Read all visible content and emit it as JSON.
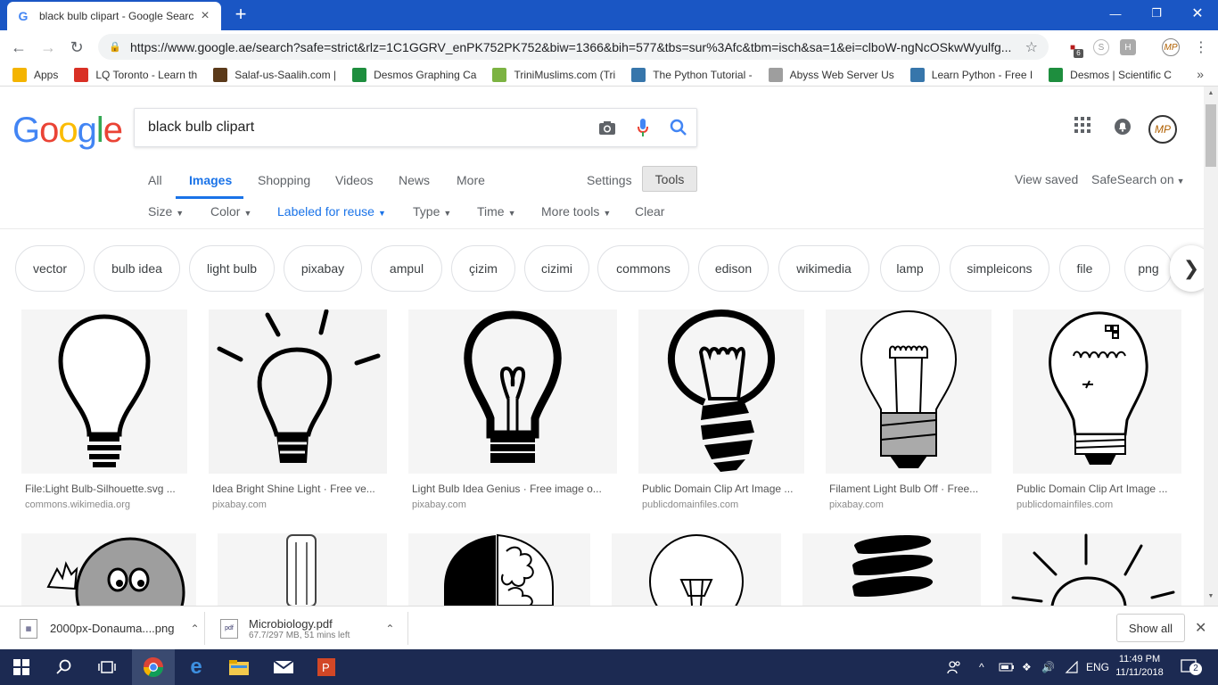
{
  "browser": {
    "tab_title": "black bulb clipart - Google Searc",
    "url": "https://www.google.ae/search?safe=strict&rlz=1C1GGRV_enPK752PK752&biw=1366&bih=577&tbs=sur%3Afc&tbm=isch&sa=1&ei=clboW-ngNcOSkwWyulfg...",
    "extension_badge": "6"
  },
  "bookmarks": [
    {
      "label": "Apps",
      "icon": "apps-grid-icon",
      "color": "#f4b400"
    },
    {
      "label": "LQ Toronto - Learn th",
      "icon": "lq-icon",
      "color": "#d93025"
    },
    {
      "label": "Salaf-us-Saalih.com |",
      "icon": "salaf-icon",
      "color": "#5b3a1a"
    },
    {
      "label": "Desmos Graphing Ca",
      "icon": "desmos-icon",
      "color": "#1e8e3e"
    },
    {
      "label": "TriniMuslims.com (Tri",
      "icon": "flag-icon",
      "color": "#7cb342"
    },
    {
      "label": "The Python Tutorial -",
      "icon": "python-icon",
      "color": "#3776ab"
    },
    {
      "label": "Abyss Web Server Us",
      "icon": "page-icon",
      "color": "#9e9e9e"
    },
    {
      "label": "Learn Python - Free I",
      "icon": "python-icon",
      "color": "#3776ab"
    },
    {
      "label": "Desmos | Scientific C",
      "icon": "desmos-icon",
      "color": "#1e8e3e"
    }
  ],
  "search": {
    "query": "black bulb clipart",
    "logo_letters": [
      {
        "ch": "G",
        "color": "#4285f4"
      },
      {
        "ch": "o",
        "color": "#ea4335"
      },
      {
        "ch": "o",
        "color": "#fbbc05"
      },
      {
        "ch": "g",
        "color": "#4285f4"
      },
      {
        "ch": "l",
        "color": "#34a853"
      },
      {
        "ch": "e",
        "color": "#ea4335"
      }
    ]
  },
  "nav_tabs": {
    "all": "All",
    "images": "Images",
    "shopping": "Shopping",
    "videos": "Videos",
    "news": "News",
    "more": "More",
    "settings": "Settings",
    "tools": "Tools"
  },
  "header_right": {
    "view_saved": "View saved",
    "safesearch": "SafeSearch on"
  },
  "filters": {
    "size": "Size",
    "color": "Color",
    "labeled": "Labeled for reuse",
    "type": "Type",
    "time": "Time",
    "more_tools": "More tools",
    "clear": "Clear"
  },
  "chips": [
    "vector",
    "bulb idea",
    "light bulb",
    "pixabay",
    "ampul",
    "çizim",
    "cizimi",
    "commons",
    "edison",
    "wikimedia",
    "lamp",
    "simpleicons",
    "file",
    "png"
  ],
  "results": [
    {
      "title": "File:Light Bulb-Silhouette.svg ...",
      "source": "commons.wikimedia.org"
    },
    {
      "title": "Idea Bright Shine Light · Free ve...",
      "source": "pixabay.com"
    },
    {
      "title": "Light Bulb Idea Genius · Free image o...",
      "source": "pixabay.com"
    },
    {
      "title": "Public Domain Clip Art Image ...",
      "source": "publicdomainfiles.com"
    },
    {
      "title": "Filament Light Bulb Off · Free...",
      "source": "pixabay.com"
    },
    {
      "title": "Public Domain Clip Art Image ...",
      "source": "publicdomainfiles.com"
    }
  ],
  "downloads": [
    {
      "name": "2000px-Donauma....png",
      "sub": ""
    },
    {
      "name": "Microbiology.pdf",
      "sub": "67.7/297 MB, 51 mins left"
    }
  ],
  "show_all": "Show all",
  "taskbar": {
    "lang": "ENG",
    "time": "11:49 PM",
    "date": "11/11/2018",
    "notifications": "2"
  }
}
